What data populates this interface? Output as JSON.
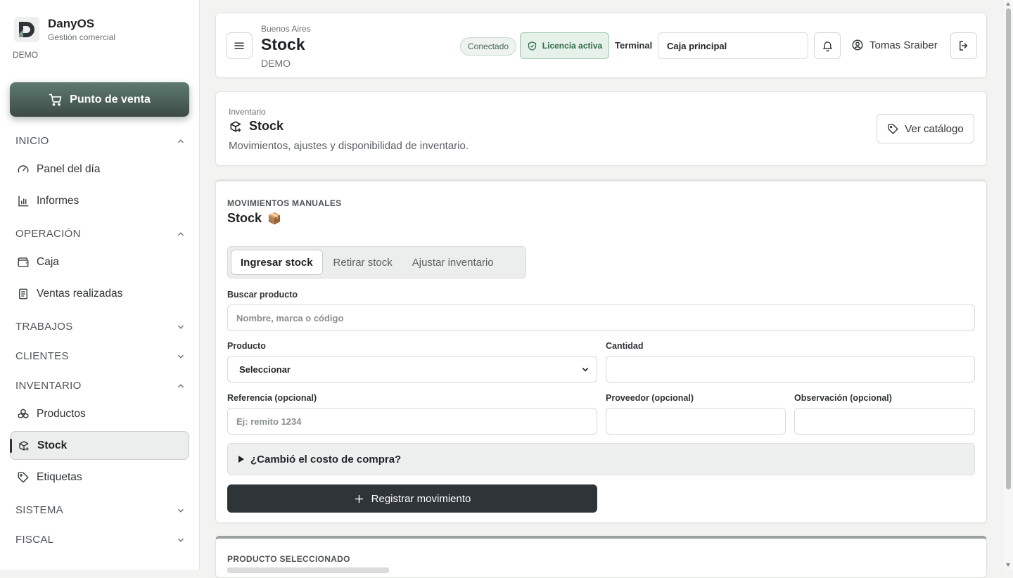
{
  "brand": {
    "name": "DanyOS",
    "subtitle": "Gestión comercial",
    "env": "DEMO"
  },
  "sidebar": {
    "pos_button": "Punto de venta",
    "sections": [
      {
        "label": "INICIO",
        "expanded": true,
        "items": [
          "Panel del día",
          "Informes"
        ]
      },
      {
        "label": "OPERACIÓN",
        "expanded": true,
        "items": [
          "Caja",
          "Ventas realizadas"
        ]
      },
      {
        "label": "TRABAJOS",
        "expanded": false
      },
      {
        "label": "CLIENTES",
        "expanded": false
      },
      {
        "label": "INVENTARIO",
        "expanded": true,
        "items": [
          "Productos",
          "Stock",
          "Etiquetas"
        ]
      },
      {
        "label": "SISTEMA",
        "expanded": false
      },
      {
        "label": "FISCAL",
        "expanded": false
      }
    ],
    "active_item": "Stock"
  },
  "header": {
    "city": "Buenos Aires",
    "title": "Stock",
    "subtitle": "DEMO",
    "status": "Conectado",
    "license": "Licencia activa",
    "terminal_label": "Terminal",
    "terminal_value": "Caja principal",
    "user": "Tomas Sraiber"
  },
  "inventory": {
    "kicker": "Inventario",
    "title": "Stock",
    "description": "Movimientos, ajustes y disponibilidad de inventario.",
    "catalog_button": "Ver catálogo"
  },
  "movements": {
    "kicker": "MOVIMIENTOS MANUALES",
    "title": "Stock",
    "title_emoji": "📦",
    "tabs": [
      "Ingresar stock",
      "Retirar stock",
      "Ajustar inventario"
    ],
    "active_tab": "Ingresar stock",
    "search_label": "Buscar producto",
    "search_placeholder": "Nombre, marca o código",
    "product_label": "Producto",
    "product_value": "Seleccionar",
    "quantity_label": "Cantidad",
    "quantity_value": "",
    "reference_label": "Referencia (opcional)",
    "reference_placeholder": "Ej: remito 1234",
    "supplier_label": "Proveedor (opcional)",
    "observation_label": "Observación (opcional)",
    "cost_toggle": "¿Cambió el costo de compra?",
    "submit": "Registrar movimiento"
  },
  "selected_product": {
    "kicker": "PRODUCTO SELECCIONADO"
  },
  "colors": {
    "accent": "#4a5e57",
    "license_green": "#2f6b46",
    "dark_button": "#2f3439"
  }
}
